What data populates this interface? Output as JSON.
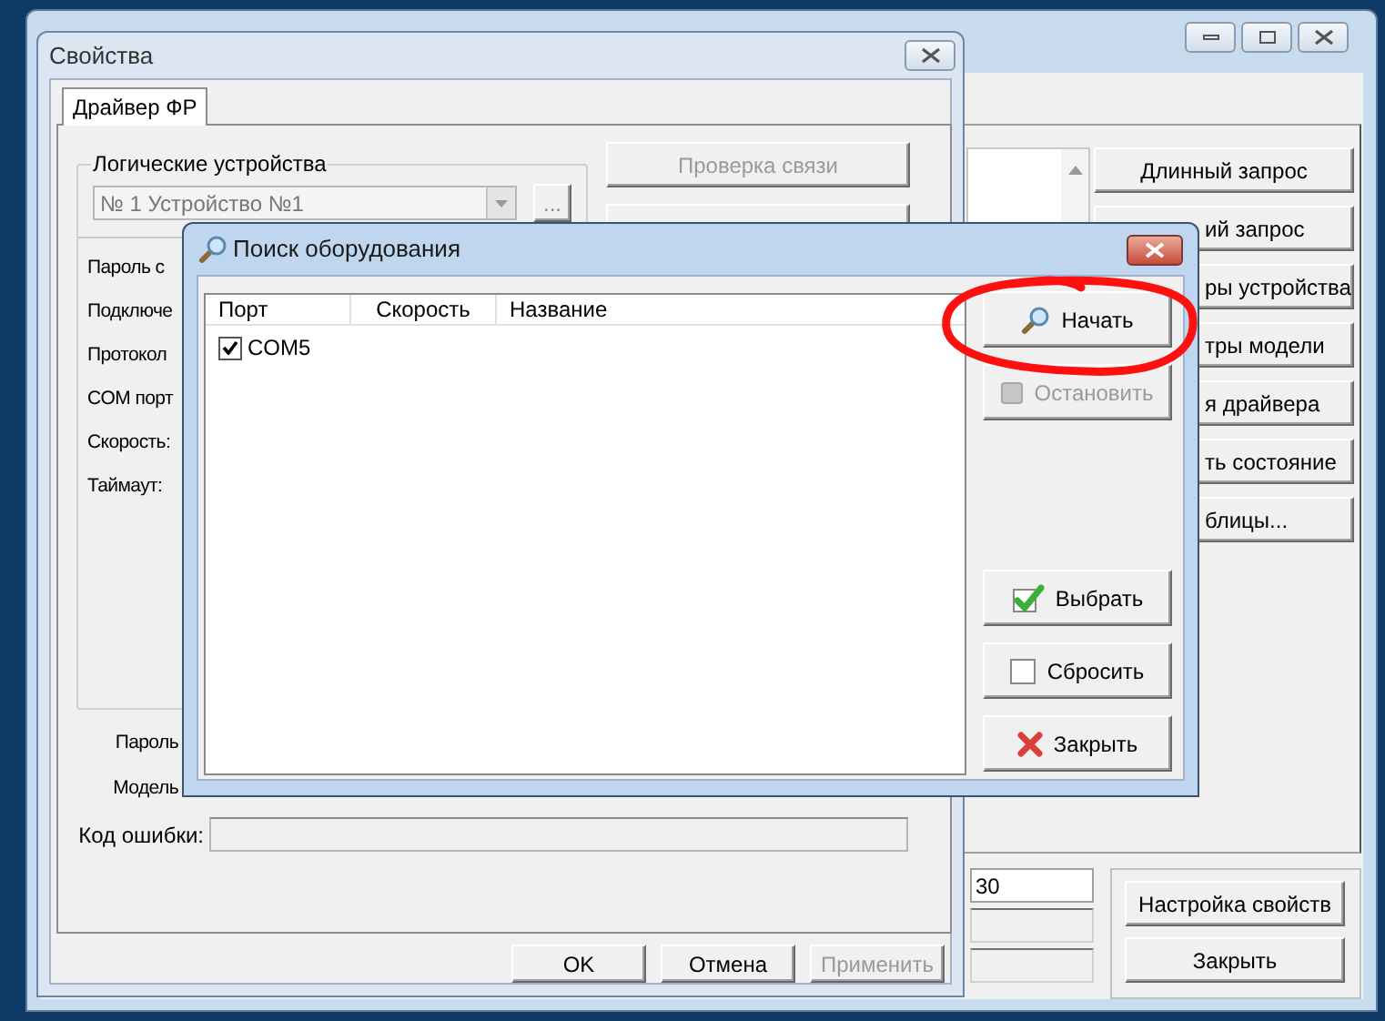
{
  "main_window": {
    "side_buttons": [
      {
        "label": "Длинный запрос",
        "kind": "whole"
      },
      {
        "label": "ий запрос",
        "kind": "cut"
      },
      {
        "label": "ры устройства",
        "kind": "cut"
      },
      {
        "label": "тры модели",
        "kind": "cut"
      },
      {
        "label": "я драйвера",
        "kind": "cut"
      },
      {
        "label": "ть состояние",
        "kind": "cut"
      },
      {
        "label": "блицы...",
        "kind": "cut"
      }
    ],
    "timeout_value": "30",
    "bottom_buttons": [
      "Настройка свойств",
      "Закрыть"
    ]
  },
  "properties_window": {
    "title": "Свойства",
    "tabs": [
      {
        "label": "Драйвер ФР",
        "selected": true
      }
    ],
    "group_title": "Логические устройства",
    "device": "№ 1 Устройство №1",
    "browse_button": "...",
    "labels": [
      "Пароль с",
      "Подключе",
      "Протокол",
      "COM порт",
      "Скорость:",
      "Таймаут:"
    ],
    "check_button": {
      "label": "Проверка связи",
      "disabled": true
    },
    "lower_labels": [
      "Пароль",
      "Модель",
      "Код ошибки:"
    ],
    "buttons": [
      {
        "label": "OK",
        "disabled": false
      },
      {
        "label": "Отмена",
        "disabled": false
      },
      {
        "label": "Применить",
        "disabled": true
      }
    ]
  },
  "search_dialog": {
    "title": "Поиск оборудования",
    "columns": [
      "Порт",
      "Скорость",
      "Название"
    ],
    "rows": [
      {
        "port": "COM5",
        "checked": true
      }
    ],
    "buttons": [
      {
        "label": "Начать",
        "kind": "search",
        "disabled": false,
        "highlighted": true
      },
      {
        "label": "Остановить",
        "kind": "stop",
        "disabled": true,
        "highlighted": false
      },
      {
        "label": "Выбрать",
        "kind": "check",
        "disabled": false,
        "highlighted": false
      },
      {
        "label": "Сбросить",
        "kind": "box",
        "disabled": false,
        "highlighted": false
      },
      {
        "label": "Закрыть",
        "kind": "cross",
        "disabled": false,
        "highlighted": false
      }
    ]
  }
}
